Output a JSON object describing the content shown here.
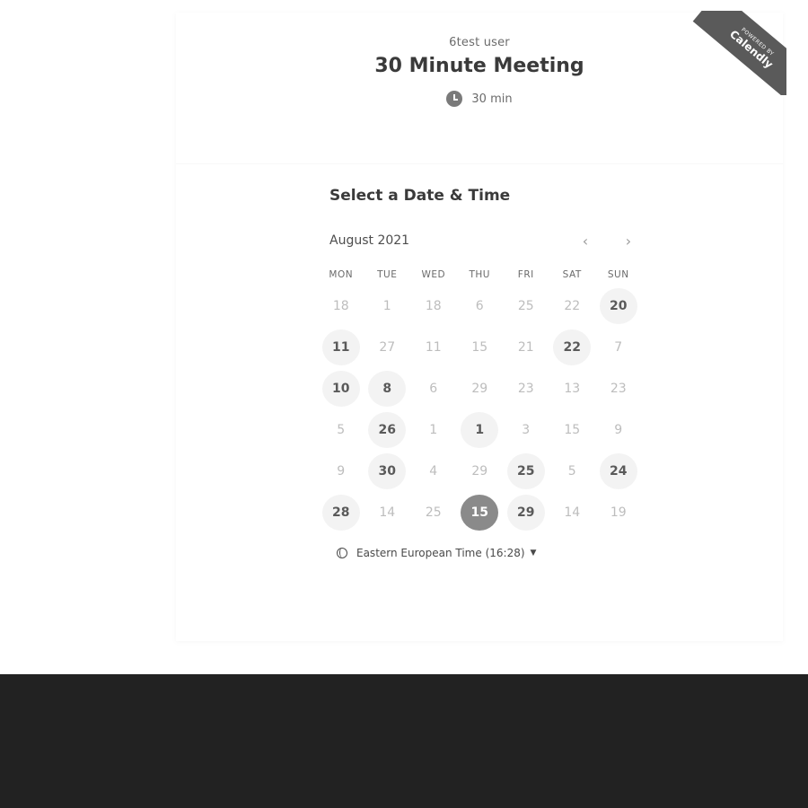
{
  "header": {
    "host": "6test user",
    "title": "30 Minute Meeting",
    "duration": "30 min"
  },
  "ribbon": {
    "small": "POWERED BY",
    "brand": "Calendly"
  },
  "calendar": {
    "section_title": "Select a Date & Time",
    "month": "August 2021",
    "weekdays": [
      "MON",
      "TUE",
      "WED",
      "THU",
      "FRI",
      "SAT",
      "SUN"
    ],
    "days": [
      {
        "label": "18",
        "state": "disabled"
      },
      {
        "label": "1",
        "state": "disabled"
      },
      {
        "label": "18",
        "state": "disabled"
      },
      {
        "label": "6",
        "state": "disabled"
      },
      {
        "label": "25",
        "state": "disabled"
      },
      {
        "label": "22",
        "state": "disabled"
      },
      {
        "label": "20",
        "state": "available"
      },
      {
        "label": "11",
        "state": "available"
      },
      {
        "label": "27",
        "state": "disabled"
      },
      {
        "label": "11",
        "state": "disabled"
      },
      {
        "label": "15",
        "state": "disabled"
      },
      {
        "label": "21",
        "state": "disabled"
      },
      {
        "label": "22",
        "state": "available"
      },
      {
        "label": "7",
        "state": "disabled"
      },
      {
        "label": "10",
        "state": "available"
      },
      {
        "label": "8",
        "state": "available"
      },
      {
        "label": "6",
        "state": "disabled"
      },
      {
        "label": "29",
        "state": "disabled"
      },
      {
        "label": "23",
        "state": "disabled"
      },
      {
        "label": "13",
        "state": "disabled"
      },
      {
        "label": "23",
        "state": "disabled"
      },
      {
        "label": "5",
        "state": "disabled"
      },
      {
        "label": "26",
        "state": "available"
      },
      {
        "label": "1",
        "state": "disabled"
      },
      {
        "label": "1",
        "state": "available"
      },
      {
        "label": "3",
        "state": "disabled"
      },
      {
        "label": "15",
        "state": "disabled"
      },
      {
        "label": "9",
        "state": "disabled"
      },
      {
        "label": "9",
        "state": "disabled"
      },
      {
        "label": "30",
        "state": "available"
      },
      {
        "label": "4",
        "state": "disabled"
      },
      {
        "label": "29",
        "state": "disabled"
      },
      {
        "label": "25",
        "state": "available"
      },
      {
        "label": "5",
        "state": "disabled"
      },
      {
        "label": "24",
        "state": "available"
      },
      {
        "label": "28",
        "state": "available"
      },
      {
        "label": "14",
        "state": "disabled"
      },
      {
        "label": "25",
        "state": "disabled"
      },
      {
        "label": "15",
        "state": "selected"
      },
      {
        "label": "29",
        "state": "available"
      },
      {
        "label": "14",
        "state": "disabled"
      },
      {
        "label": "19",
        "state": "disabled"
      }
    ]
  },
  "timezone": {
    "label": "Eastern European Time (16:28)"
  },
  "icons": {
    "duration": "clock-icon",
    "timezone": "globe-icon",
    "prev": "chevron-left-icon",
    "next": "chevron-right-icon",
    "dropdown": "caret-down-icon"
  }
}
